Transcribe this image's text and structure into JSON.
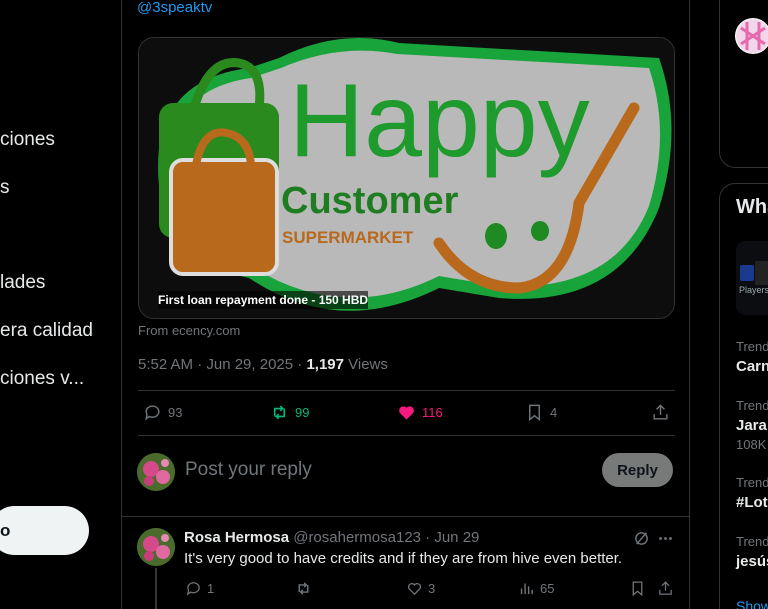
{
  "nav": {
    "items": [
      "ciones",
      "s",
      "lades",
      "era calidad",
      "ciones v..."
    ],
    "post_label": "o"
  },
  "post": {
    "handle_partial": "@3speaktv",
    "card": {
      "title_word1": "Happy",
      "title_word2": "Customer",
      "subtitle": "SUPERMARKET",
      "caption": "First loan repayment done - 150 HBD"
    },
    "from": "From ecency.com",
    "time": "5:52 AM · Jun 29, 2025 · ",
    "views_count": "1,197",
    "views_label": " Views",
    "stats": {
      "replies": "93",
      "reposts": "99",
      "likes": "116",
      "bookmarks": "4"
    }
  },
  "compose": {
    "placeholder": "Post your reply",
    "reply_label": "Reply"
  },
  "reply": {
    "name": "Rosa Hermosa",
    "handle_date": " @rosahermosa123 · Jun 29",
    "text": "It's very good to have credits and if they are from hive even better.",
    "stats": {
      "replies": "1",
      "reposts": "",
      "likes": "3",
      "views": "65"
    }
  },
  "sidebar": {
    "section_title": "Wha",
    "trends": [
      {
        "label": "Trend",
        "title": "Carn",
        "count": ""
      },
      {
        "label": "Trend",
        "title": "Jara",
        "count": "108K"
      },
      {
        "label": "Trend",
        "title": "#Lot",
        "count": ""
      },
      {
        "label": "Trend",
        "title": "jesús",
        "count": ""
      }
    ],
    "show_more": "Show",
    "ad_text": "Players"
  },
  "colors": {
    "accent": "#1d9bf0",
    "like": "#f91880",
    "repost": "#00ba7c",
    "border": "#2f3336",
    "muted": "#71767b"
  }
}
